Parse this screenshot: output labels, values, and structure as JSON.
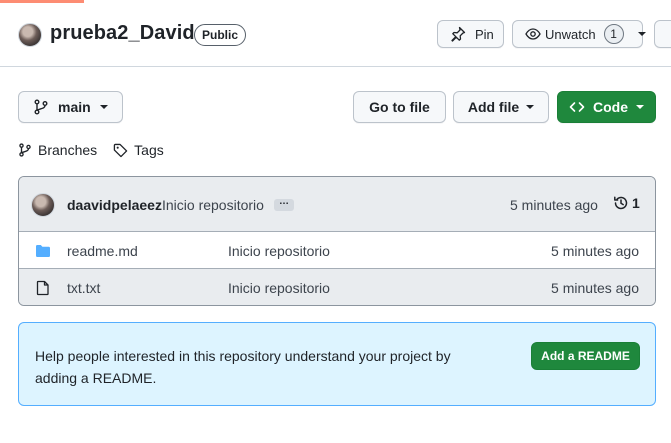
{
  "header": {
    "repo_name": "prueba2_David",
    "visibility": "Public",
    "pin_label": "Pin",
    "watch_label": "Unwatch",
    "watch_count": "1"
  },
  "toolbar": {
    "branch": "main",
    "goto_file": "Go to file",
    "add_file": "Add file",
    "code": "Code",
    "branches_link": "Branches",
    "tags_link": "Tags"
  },
  "latest_commit": {
    "author": "daavidpelaeez",
    "message": "Inicio repositorio",
    "ellipsis": "…",
    "time": "5 minutes ago",
    "commit_count": "1"
  },
  "files": [
    {
      "type": "folder",
      "name": "readme.md",
      "commit": "Inicio repositorio",
      "time": "5 minutes ago"
    },
    {
      "type": "file",
      "name": "txt.txt",
      "commit": "Inicio repositorio",
      "time": "5 minutes ago"
    }
  ],
  "readme_prompt": {
    "text": "Help people interested in this repository understand your project by adding a README.",
    "button": "Add a README"
  },
  "colors": {
    "primary_green": "#1f883d",
    "info_bg": "#ddf4ff",
    "folder_blue": "#54aeff",
    "tab_accent": "#fd8c73"
  }
}
